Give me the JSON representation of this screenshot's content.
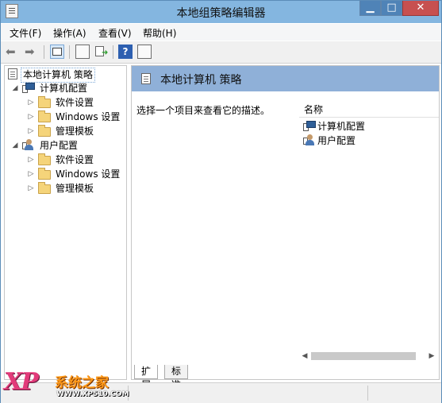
{
  "window": {
    "title": "本地组策略编辑器",
    "controls": {
      "minimize": "▁",
      "maximize": "□",
      "close": "✕"
    }
  },
  "menu": [
    {
      "label": "文件(F)"
    },
    {
      "label": "操作(A)"
    },
    {
      "label": "查看(V)"
    },
    {
      "label": "帮助(H)"
    }
  ],
  "toolbar": {
    "back_glyph": "⬅",
    "forward_glyph": "➡",
    "help_glyph": "?"
  },
  "tree": {
    "root": "本地计算机 策略",
    "computer": {
      "label": "计算机配置",
      "children": [
        "软件设置",
        "Windows 设置",
        "管理模板"
      ]
    },
    "user": {
      "label": "用户配置",
      "children": [
        "软件设置",
        "Windows 设置",
        "管理模板"
      ]
    }
  },
  "right": {
    "title": "本地计算机 策略",
    "description": "选择一个项目来查看它的描述。",
    "column_name": "名称",
    "items": [
      "计算机配置",
      "用户配置"
    ]
  },
  "tabs": [
    {
      "label": "扩展",
      "active": true
    },
    {
      "label": "标准",
      "active": false
    }
  ],
  "watermark": {
    "logo": "XP",
    "brand": "系统之家",
    "url": "WWW.XP510.COM"
  },
  "colors": {
    "titlebar": "#84b6e0",
    "header": "#8fb0d8",
    "close": "#c75050"
  }
}
